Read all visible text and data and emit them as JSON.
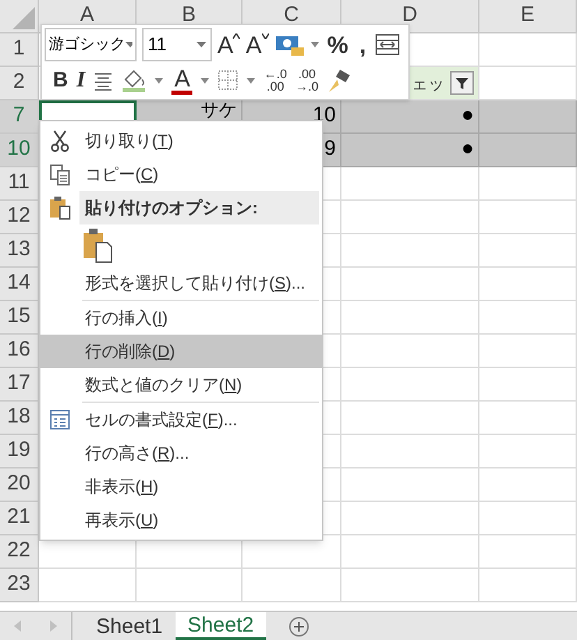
{
  "columns": [
    "A",
    "B",
    "C",
    "D",
    "E"
  ],
  "rows": [
    {
      "header": "1",
      "selected": false
    },
    {
      "header": "2",
      "selected": false,
      "D": "ェッ",
      "filter_in_D": true
    },
    {
      "header": "7",
      "selected": true,
      "active_A": true,
      "B": "サケ",
      "C": "10",
      "D": "●"
    },
    {
      "header": "10",
      "selected": true,
      "C": "9",
      "D": "●"
    },
    {
      "header": "11",
      "selected": false
    },
    {
      "header": "12",
      "selected": false
    },
    {
      "header": "13",
      "selected": false
    },
    {
      "header": "14",
      "selected": false
    },
    {
      "header": "15",
      "selected": false
    },
    {
      "header": "16",
      "selected": false
    },
    {
      "header": "17",
      "selected": false
    },
    {
      "header": "18",
      "selected": false
    },
    {
      "header": "19",
      "selected": false
    },
    {
      "header": "20",
      "selected": false
    },
    {
      "header": "21",
      "selected": false
    },
    {
      "header": "22",
      "selected": false
    },
    {
      "header": "23",
      "selected": false
    }
  ],
  "mini_toolbar": {
    "font_name": "游ゴシック",
    "font_size": "11",
    "row_1": [
      {
        "kind": "grow_font",
        "label": "A"
      },
      {
        "kind": "shrink_font",
        "label": "A"
      },
      {
        "kind": "currency"
      },
      {
        "kind": "caret"
      },
      {
        "kind": "text",
        "label": "%"
      },
      {
        "kind": "text",
        "label": ","
      },
      {
        "kind": "wrap"
      }
    ],
    "row_2": [
      {
        "kind": "bold",
        "label": "B"
      },
      {
        "kind": "italic",
        "label": "I"
      },
      {
        "kind": "align"
      },
      {
        "kind": "fill"
      },
      {
        "kind": "caret"
      },
      {
        "kind": "font_color",
        "label": "A"
      },
      {
        "kind": "caret"
      },
      {
        "kind": "borders"
      },
      {
        "kind": "caret"
      },
      {
        "kind": "decimal",
        "label": "←.0",
        "label_2": ".00"
      },
      {
        "kind": "decimal",
        "label": ".00",
        "label_2": "→.0"
      },
      {
        "kind": "painter"
      }
    ]
  },
  "context_menu": [
    {
      "kind": "cut",
      "before": "切り取り(",
      "key": "T",
      "after": ")",
      "selected": false
    },
    {
      "kind": "copy",
      "before": "コピー(",
      "key": "C",
      "after": ")",
      "selected": false
    },
    {
      "kind": "header",
      "text": "貼り付けのオプション:"
    },
    {
      "kind": "paste_option"
    },
    {
      "kind": "item",
      "before": "形式を選択して貼り付け(",
      "key": "S",
      "after": ")...",
      "selected": false
    },
    {
      "kind": "separator"
    },
    {
      "kind": "item",
      "before": "行の挿入(",
      "key": "I",
      "after": ")",
      "selected": false
    },
    {
      "kind": "item",
      "before": "行の削除(",
      "key": "D",
      "after": ")",
      "selected": true
    },
    {
      "kind": "item",
      "before": "数式と値のクリア(",
      "key": "N",
      "after": ")",
      "selected": false
    },
    {
      "kind": "separator"
    },
    {
      "kind": "format_cells",
      "before": "セルの書式設定(",
      "key": "F",
      "after": ")...",
      "selected": false
    },
    {
      "kind": "item",
      "before": "行の高さ(",
      "key": "R",
      "after": ")...",
      "selected": false
    },
    {
      "kind": "item",
      "before": "非表示(",
      "key": "H",
      "after": ")",
      "selected": false
    },
    {
      "kind": "item",
      "before": "再表示(",
      "key": "U",
      "after": ")",
      "selected": false
    }
  ],
  "sheet_tabs": [
    {
      "label": "Sheet1",
      "selected": false
    },
    {
      "label": "Sheet2",
      "selected": true
    }
  ]
}
